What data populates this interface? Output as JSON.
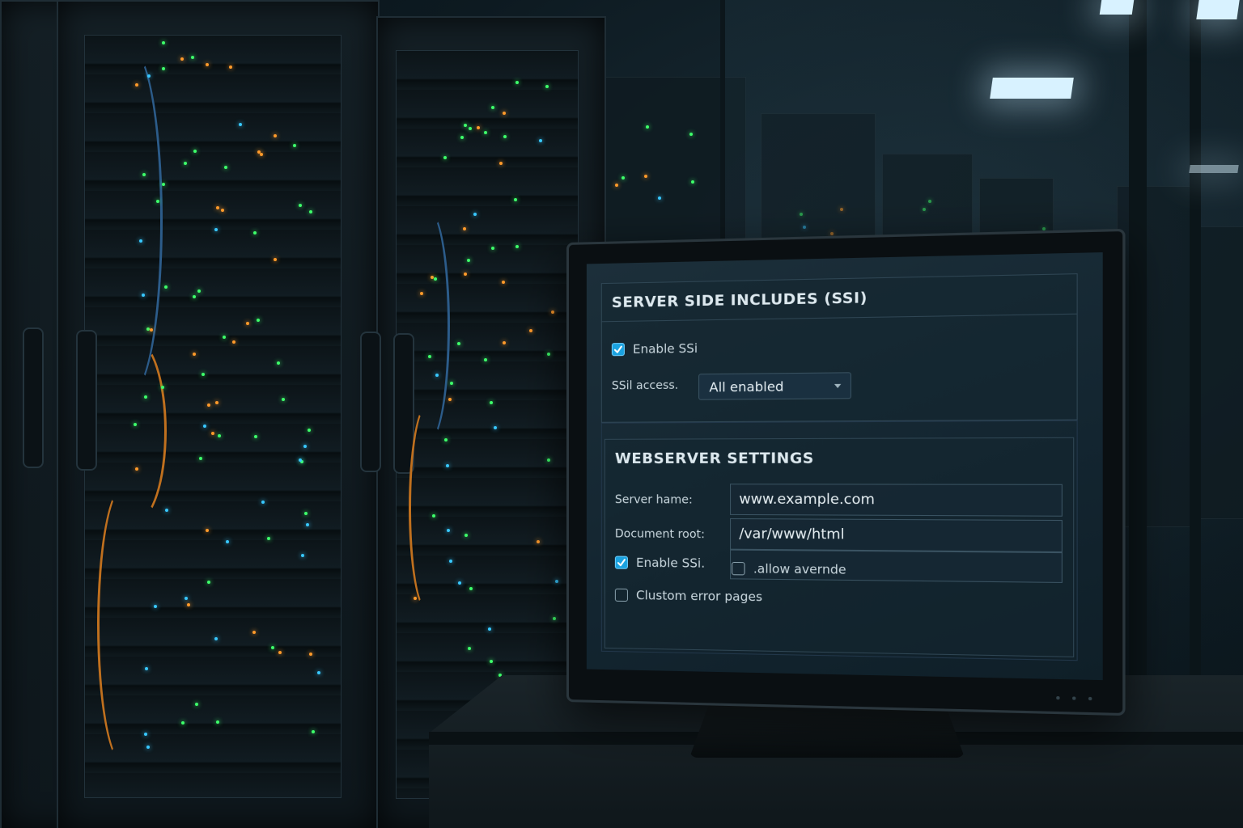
{
  "ssi_panel": {
    "title": "SERVER SIDE INCLUDES (SSI)",
    "enable_ssi": {
      "label": "Enable SSi",
      "checked": true
    },
    "access": {
      "label": "SSil access.",
      "selected": "All enabled"
    }
  },
  "webserver_panel": {
    "title": "WEBSERVER SETTINGS",
    "server_name": {
      "label": "Server hame:",
      "value": "www.example.com"
    },
    "document_root": {
      "label": "Document root:",
      "value": "/var/www/html"
    },
    "enable_ssi": {
      "label": "Enable SSi.",
      "checked": true
    },
    "allow_override": {
      "label": ".allow avernde",
      "checked": false
    },
    "custom_error_pages": {
      "label": "Clustom error pages",
      "checked": false
    }
  },
  "icons": {
    "check": "checkmark-icon",
    "dropdown": "chevron-down-icon"
  },
  "colors": {
    "accent": "#1aa2e0",
    "screen_bg": "#132530",
    "text": "#dce8ee"
  }
}
